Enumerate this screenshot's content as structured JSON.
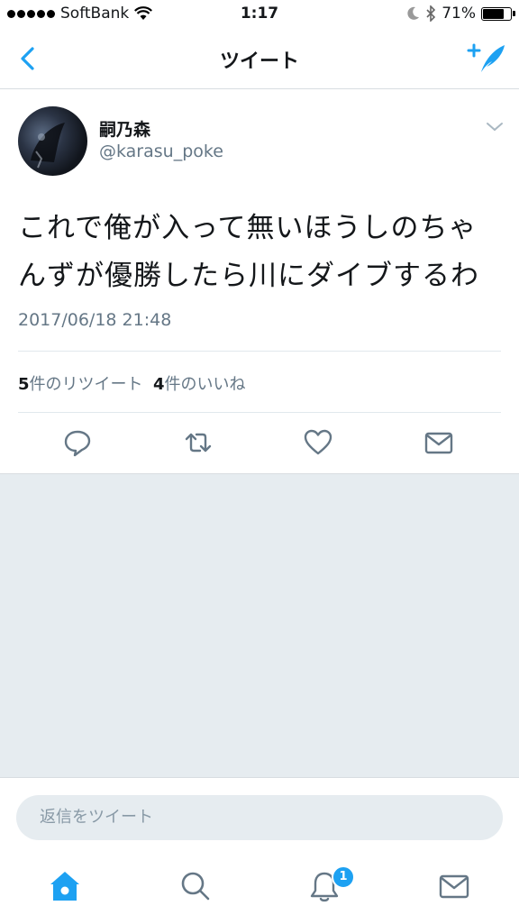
{
  "status_bar": {
    "carrier": "SoftBank",
    "time": "1:17",
    "battery": "71%"
  },
  "nav": {
    "title": "ツイート"
  },
  "tweet": {
    "author_name": "嗣乃森",
    "author_handle": "@karasu_poke",
    "text": "これで俺が入って無いほうしのちゃんずが優勝したら川にダイブするわ",
    "timestamp": "2017/06/18 21:48",
    "retweet_count": "5",
    "retweet_label": "件のリツイート",
    "like_count": "4",
    "like_label": "件のいいね"
  },
  "reply": {
    "placeholder": "返信をツイート"
  },
  "tabbar": {
    "notification_badge": "1"
  },
  "colors": {
    "accent": "#1da1f2",
    "secondary_text": "#657786",
    "background": "#e6ecf0"
  }
}
